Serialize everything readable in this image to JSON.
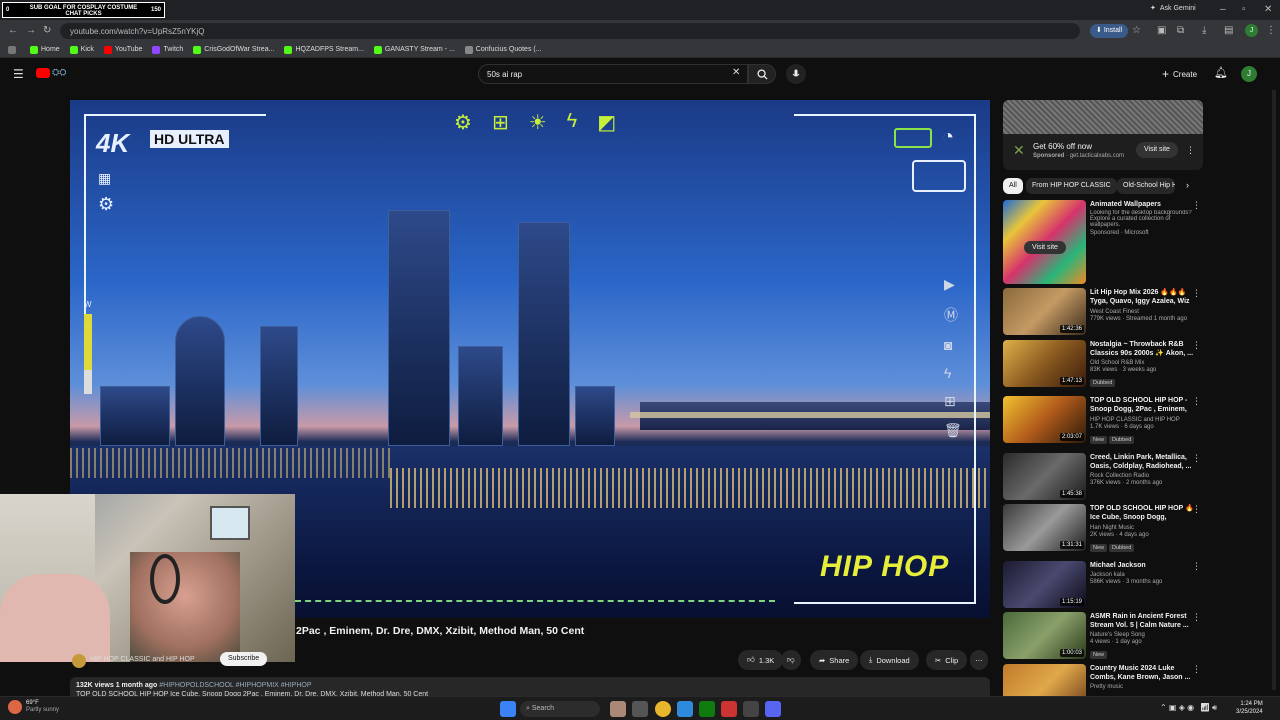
{
  "overlay": {
    "left_num": "0",
    "line1": "SUB GOAL FOR COSPLAY COSTUME",
    "line2": "CHAT PICKS",
    "right_num": "150"
  },
  "browser": {
    "url": "youtube.com/watch?v=UpRsZ5nYKjQ",
    "install_label": "Install",
    "ask_label": "Ask Gemini",
    "profile_letter": "J",
    "bookmarks": [
      {
        "label": "Home",
        "color": "#53fc18"
      },
      {
        "label": "Kick",
        "color": "#53fc18"
      },
      {
        "label": "YouTube",
        "color": "#ff0000"
      },
      {
        "label": "Twitch",
        "color": "#9146ff"
      },
      {
        "label": "CrisGodOfWar Strea...",
        "color": "#53fc18"
      },
      {
        "label": "HQZADFPS Stream...",
        "color": "#53fc18"
      },
      {
        "label": "GANASTY Stream - ...",
        "color": "#53fc18"
      },
      {
        "label": "Confucius Quotes (...",
        "color": "#888888"
      }
    ]
  },
  "header": {
    "search_value": "50s ai rap",
    "create_label": "Create",
    "avatar_letter": "J"
  },
  "video": {
    "badge_4k": "4K",
    "badge_hd": "HD ULTRA",
    "hiphop_text": "HIP HOP",
    "title": "2Pac , Eminem, Dr. Dre, DMX, Xzibit, Method Man, 50 Cent",
    "channel": "HIP HOP CLASSIC and HIP HOP",
    "subscribe_label": "Subscribe",
    "like_count": "1.3K",
    "share_label": "Share",
    "download_label": "Download",
    "clip_label": "Clip",
    "desc_meta": "132K views  1 month ago",
    "desc_tags": "#HIPHOPOLDSCHOOL #HIPHOPMIX #HIPHOP",
    "desc_line": "TOP OLD SCHOOL HIP HOP Ice Cube, Snoop Dogg 2Pac , Eminem, Dr. Dre, DMX, Xzibit, Method Man, 50 Cent"
  },
  "ad": {
    "headline": "Get 60% off now",
    "sponsored": "Sponsored",
    "domain": "get.tacticalxabs.com",
    "button": "Visit site"
  },
  "chips": [
    "All",
    "From HIP HOP CLASSIC",
    "Old-School Hip H"
  ],
  "feed": [
    {
      "title": "Animated Wallpapers",
      "line2": "Looking for the desktop backgrounds? Explore a curated collection of wallpapers.",
      "channel": "Sponsored · Microsoft",
      "meta": "",
      "duration": "",
      "badges": [],
      "button": "Visit site",
      "thumb": "linear-gradient(135deg,#1e6bd6,#e8c53a,#d6336c,#29b57a,#f08a24)"
    },
    {
      "title": "Lit Hip Hop Mix 2026 🔥🔥🔥 Tyga, Quavo, Iggy Azalea, Wiz ...",
      "channel": "West Coast Finest",
      "meta": "779K views · Streamed 1 month ago",
      "duration": "1:42:36",
      "badges": [],
      "thumb": "linear-gradient(135deg,#8a6a3a,#c49a64,#3c2a1a)"
    },
    {
      "title": "Nostalgia ~ Throwback R&B Classics 90s 2000s ✨ Akon, ...",
      "channel": "Old School R&B Mix",
      "meta": "83K views · 3 weeks ago",
      "duration": "1:47:13",
      "badges": [
        "Dubbed"
      ],
      "thumb": "linear-gradient(135deg,#e0b04a,#8a5a20,#3a1a0a)"
    },
    {
      "title": "TOP OLD SCHOOL HIP HOP - Snoop Dogg, 2Pac , Eminem, D...",
      "channel": "HIP HOP CLASSIC and HIP HOP",
      "meta": "1.7K views · 6 days ago",
      "duration": "2:03:07",
      "badges": [
        "New",
        "Dubbed"
      ],
      "thumb": "linear-gradient(135deg,#f2c230,#b05a1a,#2a1a0a)"
    },
    {
      "title": "Creed, Linkin Park, Metallica, Oasis, Coldplay, Radiohead, ...",
      "channel": "Rock Collection Radio",
      "meta": "376K views · 2 months ago",
      "duration": "1:45:38",
      "badges": [],
      "thumb": "linear-gradient(135deg,#2a2a2a,#6a6a6a,#1a1a1a)"
    },
    {
      "title": "TOP OLD SCHOOL HIP HOP 🔥 Ice Cube, Snoop Dogg, Emine...",
      "channel": "Han Night Music",
      "meta": "2K views · 4 days ago",
      "duration": "1:31:31",
      "badges": [
        "New",
        "Dubbed"
      ],
      "thumb": "linear-gradient(135deg,#3a3a3a,#9a9a9a,#1e1e1e)"
    },
    {
      "title": "Michael Jackson",
      "channel": "Jackson kala",
      "meta": "586K views · 3 months ago",
      "duration": "1:15:19",
      "badges": [],
      "thumb": "linear-gradient(135deg,#1a1a30,#4a4a70,#0a0a1a)"
    },
    {
      "title": "ASMR Rain in Ancient Forest Stream Vol. 5 | Calm Nature ...",
      "channel": "Nature's Sleep Song",
      "meta": "4 views · 1 day ago",
      "duration": "1:00:03",
      "badges": [
        "New"
      ],
      "thumb": "linear-gradient(135deg,#4a6a3a,#8aa06a,#2a3a1a)"
    },
    {
      "title": "Country Music 2024 Luke Combs, Kane Brown, Jason ...",
      "channel": "Pretty music",
      "meta": "",
      "duration": "",
      "badges": [],
      "thumb": "linear-gradient(135deg,#c07a2a,#e0a84a,#6a3a1a)"
    }
  ],
  "taskbar": {
    "search": "Search",
    "weather_temp": "69°F",
    "weather_desc": "Partly sunny",
    "time": "1:24 PM",
    "date": "3/25/2024"
  }
}
